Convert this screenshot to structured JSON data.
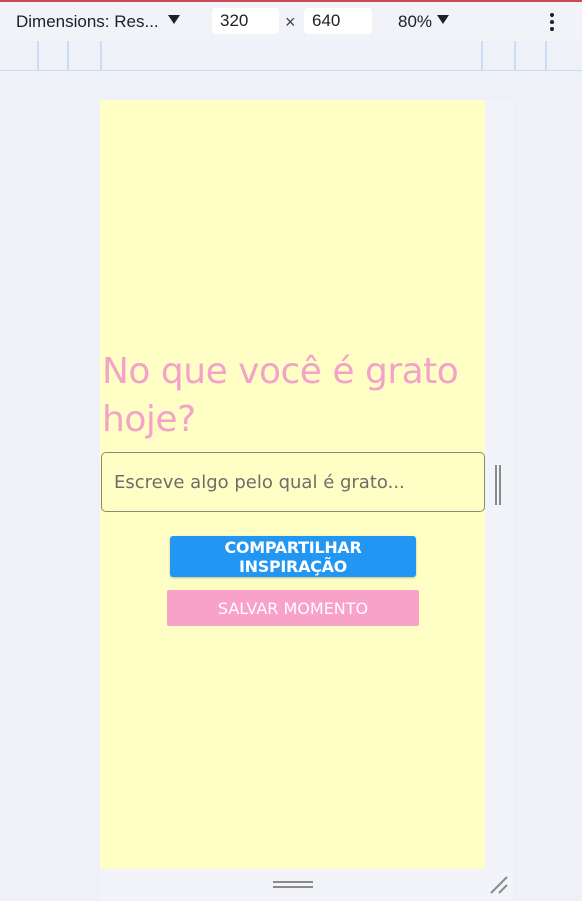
{
  "devtools": {
    "dimensions_label": "Dimensions: Res...",
    "width_value": "320",
    "times_symbol": "×",
    "height_value": "640",
    "zoom_label": "80%",
    "accent_color": "#c94a52"
  },
  "app": {
    "background_color": "#ffffc5",
    "heading": "No que você é grato hoje?",
    "heading_color": "#f4a3c8",
    "input_placeholder": "Escreve algo pelo qual é grato...",
    "share_button_label": "COMPARTILHAR INSPIRAÇÃO",
    "share_button_color": "#2196f3",
    "save_button_label": "SALVAR MOMENTO",
    "save_button_color": "#f9a2c9"
  },
  "icons": [
    "caret-down-icon",
    "more-vert-icon",
    "resize-handle-icon",
    "resize-corner-icon"
  ]
}
